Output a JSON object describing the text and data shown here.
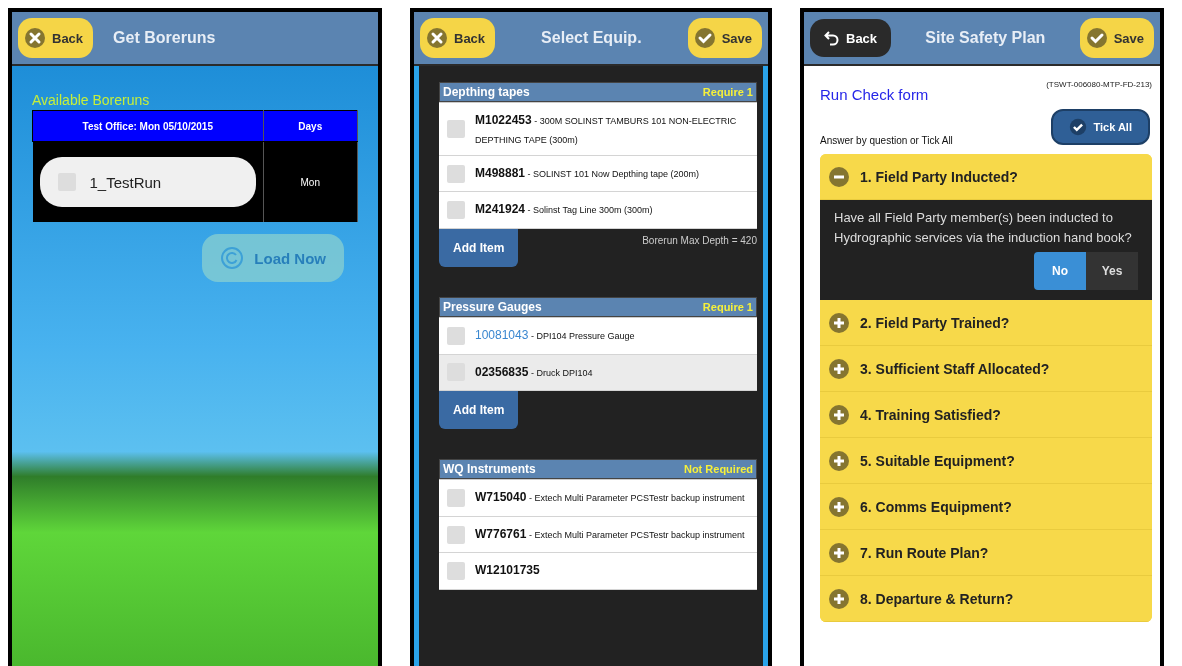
{
  "screens": [
    {
      "kind": "boreruns",
      "header": {
        "back": {
          "label": "Back"
        },
        "title": "Get Boreruns"
      },
      "section_label": "Available Boreruns",
      "table": {
        "columns": [
          "Test Office: Mon 05/10/2015",
          "Days"
        ],
        "rows": [
          {
            "run": "1_TestRun",
            "checked": false,
            "days": "Mon"
          }
        ]
      },
      "load_button": {
        "label": "Load Now",
        "disabled": true
      }
    },
    {
      "kind": "equipment",
      "header": {
        "back": {
          "label": "Back"
        },
        "title": "Select Equip.",
        "save": {
          "label": "Save"
        }
      },
      "sections": [
        {
          "title": "Depthing tapes",
          "requirement": "Require 1",
          "note": "Borerun Max Depth = 420",
          "add_button": "Add Item",
          "items": [
            {
              "code": "M1022453",
              "description": "- 300M SOLINST TAMBURS 101 NON-ELECTRIC DEPTHING TAPE (300m)",
              "link": false,
              "selected": false,
              "checked": false
            },
            {
              "code": "M498881",
              "description": "- SOLINST 101 Now Depthing tape (200m)",
              "link": false,
              "selected": false,
              "checked": false
            },
            {
              "code": "M241924",
              "description": "- Solinst Tag Line 300m (300m)",
              "link": false,
              "selected": false,
              "checked": false
            }
          ]
        },
        {
          "title": "Pressure Gauges",
          "requirement": "Require 1",
          "add_button": "Add Item",
          "items": [
            {
              "code": "10081043",
              "description": "- DPI104 Pressure Gauge",
              "link": true,
              "selected": false,
              "checked": false
            },
            {
              "code": "02356835",
              "description": "- Druck DPI104",
              "link": false,
              "selected": true,
              "checked": false
            }
          ]
        },
        {
          "title": "WQ Instruments",
          "requirement": "Not Required",
          "items": [
            {
              "code": "W715040",
              "description": "- Extech Multi Parameter PCSTestr backup instrument",
              "link": false,
              "selected": false,
              "checked": false
            },
            {
              "code": "W776761",
              "description": "- Extech Multi Parameter PCSTestr backup instrument",
              "link": false,
              "selected": false,
              "checked": false
            },
            {
              "code": "W12101735",
              "link": false,
              "selected": false,
              "checked": false
            }
          ]
        }
      ]
    },
    {
      "kind": "checklist",
      "header": {
        "back": {
          "label": "Back"
        },
        "title": "Site Safety Plan",
        "save": {
          "label": "Save"
        }
      },
      "form_title": "Run Check form",
      "reference": "(TSWT-006080-MTP-FD-213)",
      "tick_all": "Tick All",
      "hint": "Answer by question or Tick All",
      "questions": [
        {
          "label": "1. Field Party Inducted?",
          "expanded": true,
          "body": "Have all Field Party member(s) been inducted to Hydrographic services via the induction hand book?",
          "options": [
            {
              "label": "No",
              "selected": true
            },
            {
              "label": "Yes",
              "selected": false
            }
          ]
        },
        {
          "label": "2. Field Party Trained?",
          "expanded": false
        },
        {
          "label": "3. Sufficient Staff Allocated?",
          "expanded": false
        },
        {
          "label": "4. Training Satisfied?",
          "expanded": false
        },
        {
          "label": "5. Suitable Equipment?",
          "expanded": false
        },
        {
          "label": "6. Comms Equipment?",
          "expanded": false
        },
        {
          "label": "7. Run Route Plan?",
          "expanded": false
        },
        {
          "label": "8. Departure & Return?",
          "expanded": false
        }
      ]
    }
  ]
}
